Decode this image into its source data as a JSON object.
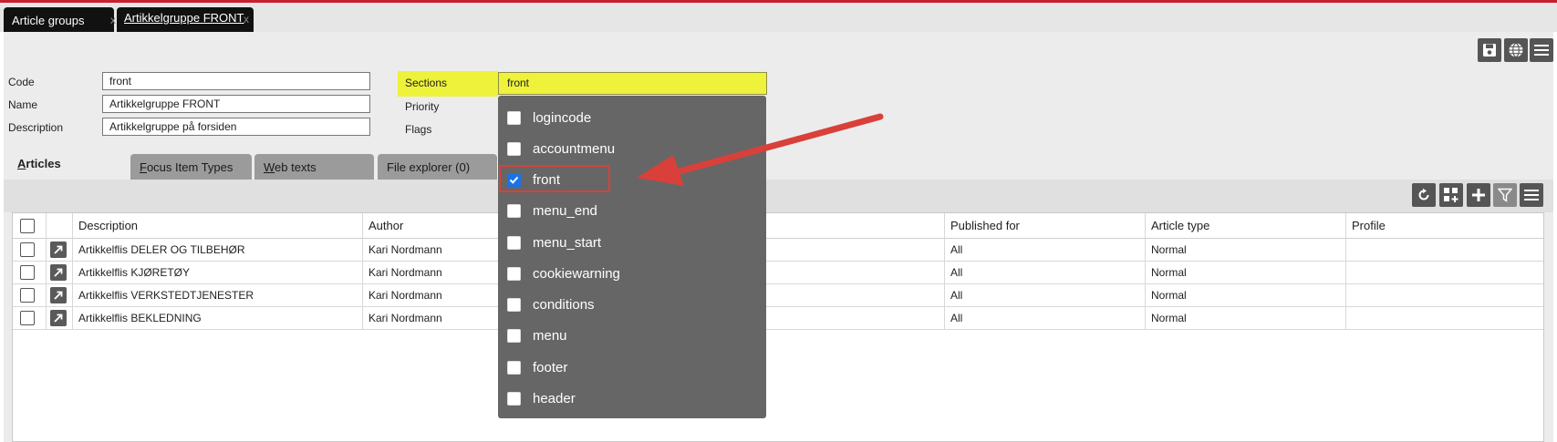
{
  "tabs": {
    "tab1": {
      "label": "Article groups",
      "close": "x"
    },
    "tab2": {
      "label": "Artikkelgruppe FRONT",
      "close": "x"
    }
  },
  "form": {
    "code_label": "Code",
    "code_value": "front",
    "name_label": "Name",
    "name_value": "Artikkelgruppe FRONT",
    "description_label": "Description",
    "description_value": "Artikkelgruppe på forsiden",
    "sections_label": "Sections",
    "sections_value": "front",
    "priority_label": "Priority",
    "flags_label": "Flags"
  },
  "subtabs": {
    "articles": {
      "first": "A",
      "rest": "rticles"
    },
    "focus": {
      "first": "F",
      "rest": "ocus Item Types"
    },
    "web": {
      "first": "W",
      "rest": "eb texts"
    },
    "files": {
      "label": "File explorer (0)"
    }
  },
  "grid": {
    "columns": {
      "description": "Description",
      "author": "Author",
      "published_for": "Published for",
      "article_type": "Article type",
      "profile": "Profile"
    },
    "rows": [
      {
        "description": "Artikkelflis DELER OG TILBEHØR",
        "author": "Kari Nordmann",
        "published_for": "All",
        "article_type": "Normal"
      },
      {
        "description": "Artikkelflis KJØRETØY",
        "author": "Kari Nordmann",
        "published_for": "All",
        "article_type": "Normal"
      },
      {
        "description": "Artikkelflis VERKSTEDTJENESTER",
        "author": "Kari Nordmann",
        "published_for": "All",
        "article_type": "Normal"
      },
      {
        "description": "Artikkelflis BEKLEDNING",
        "author": "Kari Nordmann",
        "published_for": "All",
        "article_type": "Normal"
      }
    ]
  },
  "sections_dropdown": {
    "options": [
      {
        "label": "logincode",
        "checked": false
      },
      {
        "label": "accountmenu",
        "checked": false
      },
      {
        "label": "front",
        "checked": true
      },
      {
        "label": "menu_end",
        "checked": false
      },
      {
        "label": "menu_start",
        "checked": false
      },
      {
        "label": "cookiewarning",
        "checked": false
      },
      {
        "label": "conditions",
        "checked": false
      },
      {
        "label": "menu",
        "checked": false
      },
      {
        "label": "footer",
        "checked": false
      },
      {
        "label": "header",
        "checked": false
      }
    ]
  },
  "icons": {
    "top_toolbar": [
      "save-icon",
      "globe-icon",
      "menu-icon"
    ],
    "grid_toolbar": [
      "refresh-icon",
      "grid-add-icon",
      "plus-icon",
      "filter-icon",
      "menu-icon"
    ]
  },
  "colors": {
    "accent_red": "#c8202e",
    "highlight_yellow": "#eef23a",
    "annotation_red": "#d9403a",
    "checkbox_blue": "#1a73e8",
    "dropdown_bg": "#666666"
  }
}
